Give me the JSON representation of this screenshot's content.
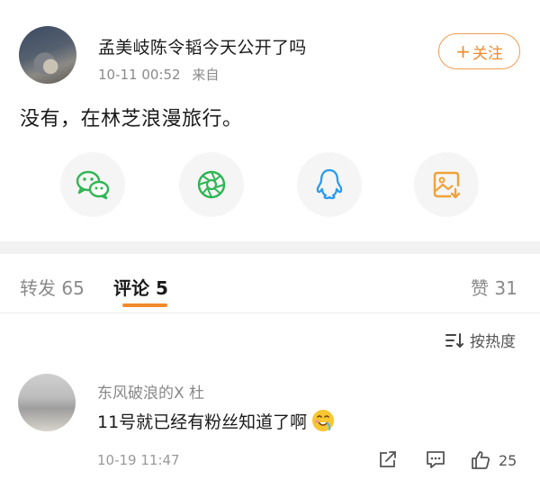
{
  "post": {
    "username": "孟美岐陈令韬今天公开了吗",
    "time": "10-11 00:52",
    "source": "来自",
    "follow_label": "关注",
    "content": "没有，在林芝浪漫旅行。"
  },
  "share": [
    {
      "icon": "wechat-icon"
    },
    {
      "icon": "moments-icon"
    },
    {
      "icon": "qq-icon"
    },
    {
      "icon": "save-image-icon"
    }
  ],
  "tabs": {
    "repost": "转发 65",
    "comment": "评论 5",
    "like": "赞 31"
  },
  "sort": {
    "label": "按热度"
  },
  "comment": {
    "name": "东风破浪的X 杜",
    "text": "11号就已经有粉丝知道了啊",
    "time": "10-19 11:47",
    "likes": "25"
  },
  "colors": {
    "accent": "#f08a2c",
    "wechat": "#2fb553",
    "qq": "#2b9bec",
    "save": "#f0a23a"
  }
}
